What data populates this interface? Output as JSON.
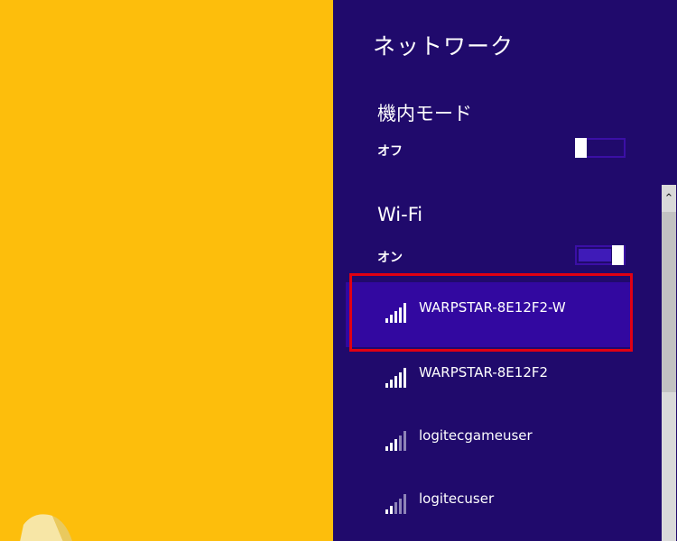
{
  "panel": {
    "title": "ネットワーク",
    "airplane": {
      "label": "機内モード",
      "state": "オフ",
      "on": false
    },
    "wifi": {
      "label": "Wi-Fi",
      "state": "オン",
      "on": true
    },
    "networks": [
      {
        "name": "WARPSTAR-8E12F2-W",
        "selected": true,
        "signal_bars": 5
      },
      {
        "name": "WARPSTAR-8E12F2",
        "selected": false,
        "signal_bars": 5
      },
      {
        "name": "logitecgameuser",
        "selected": false,
        "signal_bars": 3
      },
      {
        "name": "logitecuser",
        "selected": false,
        "signal_bars": 2
      }
    ]
  },
  "colors": {
    "panel_bg": "#200A6C",
    "selected_bg": "#3208A0",
    "highlight_border": "#E10012",
    "desktop_bg": "#FDBE0C"
  },
  "icons": {
    "scroll_up": "chevron-up-icon",
    "signal": "wifi-signal-icon"
  }
}
